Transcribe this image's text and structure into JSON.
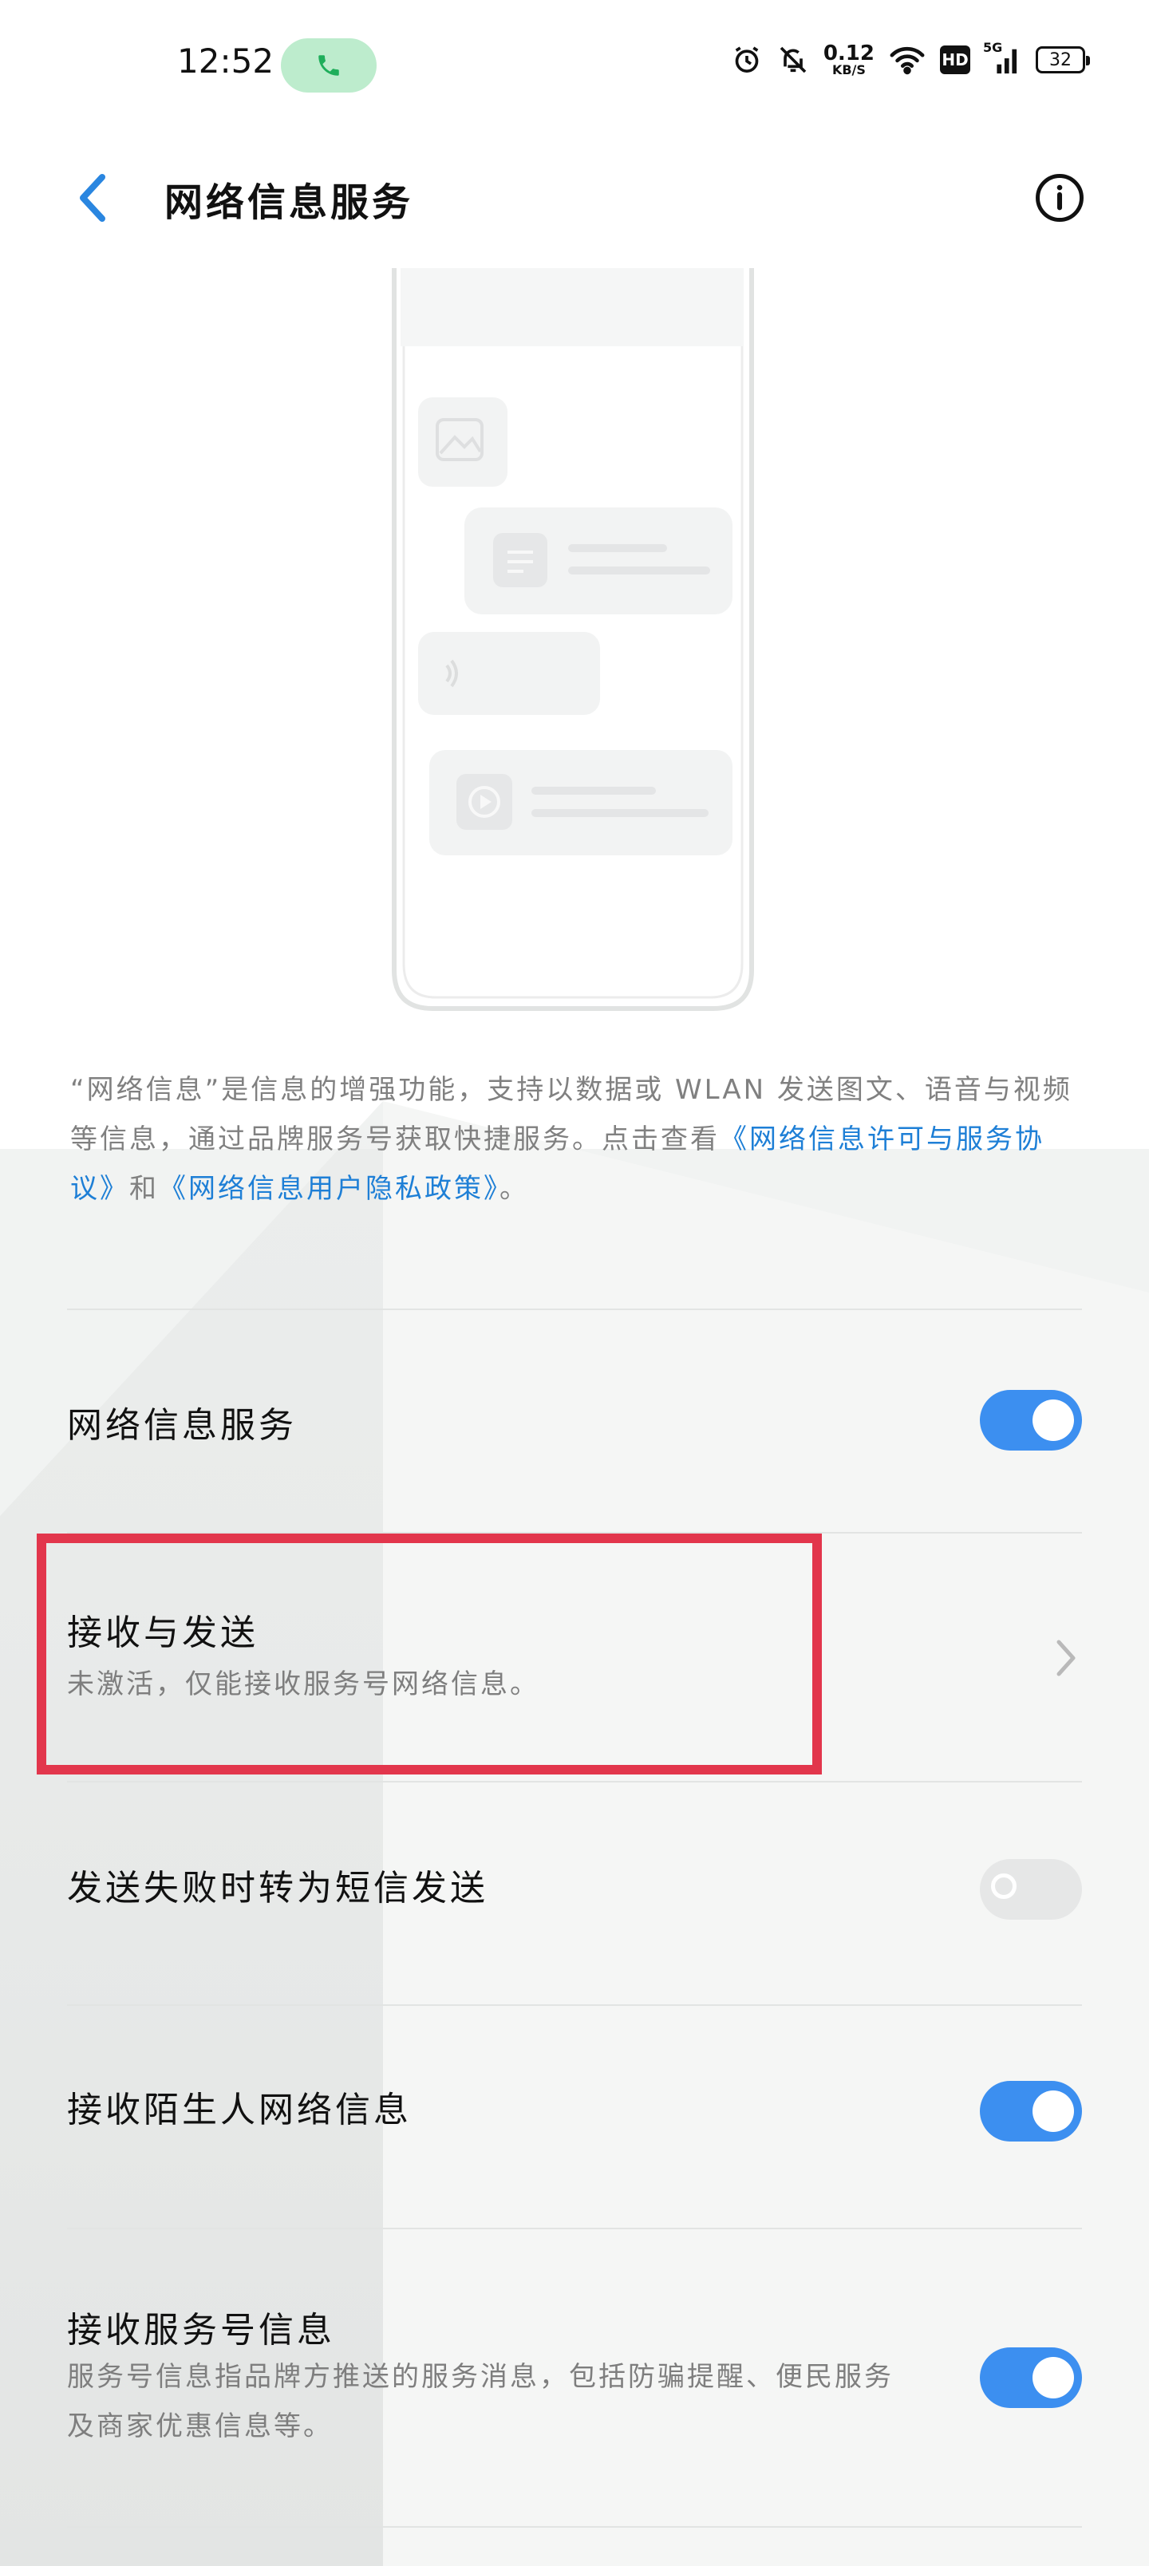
{
  "status_bar": {
    "time": "12:52",
    "net_speed_value": "0.12",
    "net_speed_unit": "KB/S",
    "hd_label": "HD",
    "signal_label": "5G",
    "battery_level": "32"
  },
  "header": {
    "title": "网络信息服务"
  },
  "description": {
    "text": "“网络信息”是信息的增强功能，支持以数据或 WLAN 发送图文、语音与视频等信息，通过品牌服务号获取快捷服务。点击查看",
    "link1": "《网络信息许可与服务协议》",
    "conjunction": "和",
    "link2": "《网络信息用户隐私政策》",
    "end": "。"
  },
  "settings": [
    {
      "title": "网络信息服务",
      "state": "on"
    },
    {
      "title": "接收与发送",
      "subtitle": "未激活，仅能接收服务号网络信息。"
    },
    {
      "title": "发送失败时转为短信发送",
      "state": "off"
    },
    {
      "title": "接收陌生人网络信息",
      "state": "on"
    },
    {
      "title": "接收服务号信息",
      "subtitle": "服务号信息指品牌方推送的服务消息，包括防骗提醒、便民服务及商家优惠信息等。",
      "state": "on"
    }
  ],
  "colors": {
    "accent": "#3c8ff0",
    "link": "#1e7fd6",
    "highlight": "#e2364c",
    "call_pill": "#bdeccd"
  }
}
